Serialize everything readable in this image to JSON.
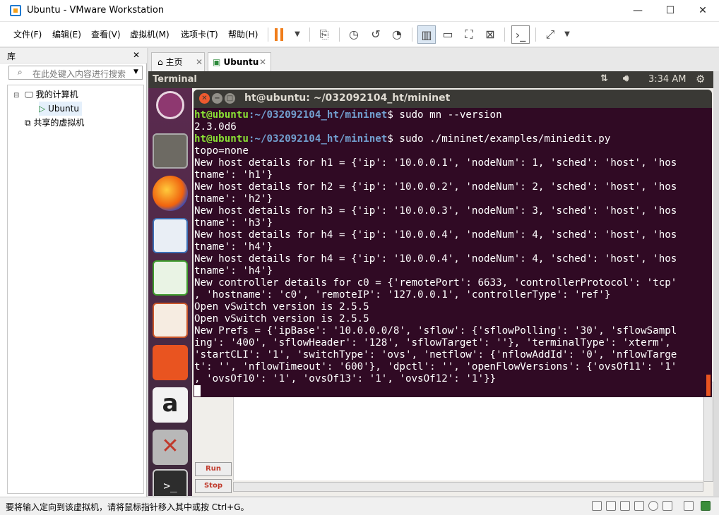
{
  "window": {
    "title": "Ubuntu - VMware Workstation"
  },
  "menu": [
    "文件(F)",
    "编辑(E)",
    "查看(V)",
    "虚拟机(M)",
    "选项卡(T)",
    "帮助(H)"
  ],
  "library": {
    "title": "库",
    "close": "✕",
    "search_placeholder": "在此处键入内容进行搜索",
    "tree": {
      "root": "我的计算机",
      "vm": "Ubuntu",
      "shared": "共享的虚拟机"
    }
  },
  "tabs": [
    {
      "label": "主页"
    },
    {
      "label": "Ubuntu"
    }
  ],
  "ubuntu": {
    "app_name": "Terminal",
    "time": "3:34 AM"
  },
  "terminal": {
    "title": "ht@ubuntu: ~/032092104_ht/mininet",
    "prompt_user": "ht@ubuntu",
    "prompt_path": ":~/032092104_ht/mininet",
    "cmd1": "$ sudo mn --version",
    "out1": "2.3.0d6",
    "cmd2": "$ sudo ./mininet/examples/miniedit.py",
    "lines": [
      "topo=none",
      "New host details for h1 = {'ip': '10.0.0.1', 'nodeNum': 1, 'sched': 'host', 'hos",
      "tname': 'h1'}",
      "New host details for h2 = {'ip': '10.0.0.2', 'nodeNum': 2, 'sched': 'host', 'hos",
      "tname': 'h2'}",
      "New host details for h3 = {'ip': '10.0.0.3', 'nodeNum': 3, 'sched': 'host', 'hos",
      "tname': 'h3'}",
      "New host details for h4 = {'ip': '10.0.0.4', 'nodeNum': 4, 'sched': 'host', 'hos",
      "tname': 'h4'}",
      "New host details for h4 = {'ip': '10.0.0.4', 'nodeNum': 4, 'sched': 'host', 'hos",
      "tname': 'h4'}",
      "New controller details for c0 = {'remotePort': 6633, 'controllerProtocol': 'tcp'",
      ", 'hostname': 'c0', 'remoteIP': '127.0.0.1', 'controllerType': 'ref'}",
      "Open vSwitch version is 2.5.5",
      "Open vSwitch version is 2.5.5",
      "New Prefs = {'ipBase': '10.0.0.0/8', 'sflow': {'sflowPolling': '30', 'sflowSampl",
      "ing': '400', 'sflowHeader': '128', 'sflowTarget': ''}, 'terminalType': 'xterm',",
      "'startCLI': '1', 'switchType': 'ovs', 'netflow': {'nflowAddId': '0', 'nflowTarge",
      "t': '', 'nflowTimeout': '600'}, 'dpctl': '', 'openFlowVersions': {'ovsOf11': '1'",
      ", 'ovsOf10': '1', 'ovsOf13': '1', 'ovsOf12': '1'}}"
    ]
  },
  "miniedit": {
    "run": "Run",
    "stop": "Stop"
  },
  "status": {
    "message": "要将输入定向到该虚拟机，请将鼠标指针移入其中或按 Ctrl+G。"
  }
}
